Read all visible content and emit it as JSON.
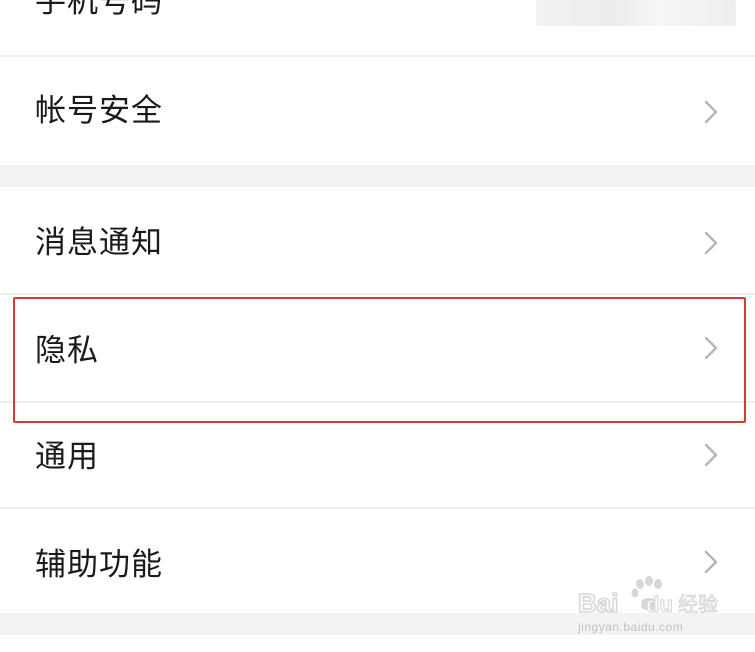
{
  "settings": {
    "items": [
      {
        "label": "手机号码",
        "has_value": true
      },
      {
        "label": "帐号安全"
      },
      {
        "label": "消息通知"
      },
      {
        "label": "隐私"
      },
      {
        "label": "通用"
      },
      {
        "label": "辅助功能"
      }
    ]
  },
  "annotation": {
    "highlight_color": "#d9383a",
    "highlighted_item": "隐私"
  },
  "watermark": {
    "brand": "Baidu经验",
    "url": "jingyan.baidu.com"
  },
  "icons": {
    "chevron": "chevron-right-icon"
  }
}
